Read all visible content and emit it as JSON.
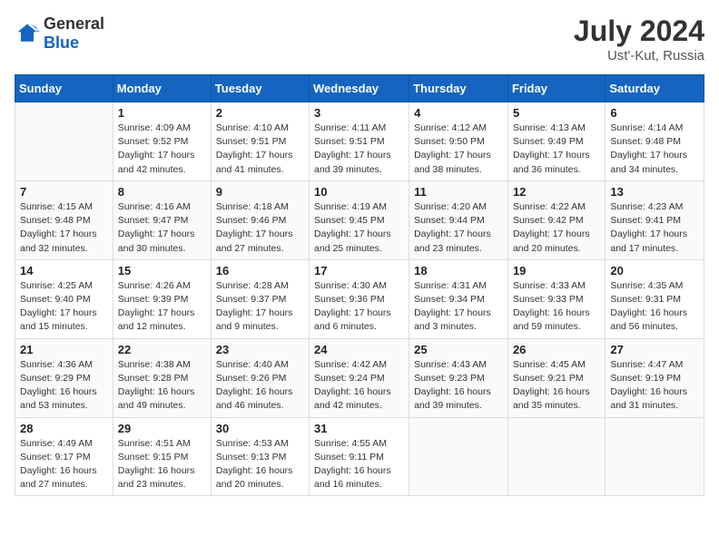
{
  "header": {
    "logo_general": "General",
    "logo_blue": "Blue",
    "month_year": "July 2024",
    "location": "Ust'-Kut, Russia"
  },
  "days_of_week": [
    "Sunday",
    "Monday",
    "Tuesday",
    "Wednesday",
    "Thursday",
    "Friday",
    "Saturday"
  ],
  "weeks": [
    [
      {
        "day": "",
        "detail": ""
      },
      {
        "day": "1",
        "detail": "Sunrise: 4:09 AM\nSunset: 9:52 PM\nDaylight: 17 hours and 42 minutes."
      },
      {
        "day": "2",
        "detail": "Sunrise: 4:10 AM\nSunset: 9:51 PM\nDaylight: 17 hours and 41 minutes."
      },
      {
        "day": "3",
        "detail": "Sunrise: 4:11 AM\nSunset: 9:51 PM\nDaylight: 17 hours and 39 minutes."
      },
      {
        "day": "4",
        "detail": "Sunrise: 4:12 AM\nSunset: 9:50 PM\nDaylight: 17 hours and 38 minutes."
      },
      {
        "day": "5",
        "detail": "Sunrise: 4:13 AM\nSunset: 9:49 PM\nDaylight: 17 hours and 36 minutes."
      },
      {
        "day": "6",
        "detail": "Sunrise: 4:14 AM\nSunset: 9:48 PM\nDaylight: 17 hours and 34 minutes."
      }
    ],
    [
      {
        "day": "7",
        "detail": "Sunrise: 4:15 AM\nSunset: 9:48 PM\nDaylight: 17 hours and 32 minutes."
      },
      {
        "day": "8",
        "detail": "Sunrise: 4:16 AM\nSunset: 9:47 PM\nDaylight: 17 hours and 30 minutes."
      },
      {
        "day": "9",
        "detail": "Sunrise: 4:18 AM\nSunset: 9:46 PM\nDaylight: 17 hours and 27 minutes."
      },
      {
        "day": "10",
        "detail": "Sunrise: 4:19 AM\nSunset: 9:45 PM\nDaylight: 17 hours and 25 minutes."
      },
      {
        "day": "11",
        "detail": "Sunrise: 4:20 AM\nSunset: 9:44 PM\nDaylight: 17 hours and 23 minutes."
      },
      {
        "day": "12",
        "detail": "Sunrise: 4:22 AM\nSunset: 9:42 PM\nDaylight: 17 hours and 20 minutes."
      },
      {
        "day": "13",
        "detail": "Sunrise: 4:23 AM\nSunset: 9:41 PM\nDaylight: 17 hours and 17 minutes."
      }
    ],
    [
      {
        "day": "14",
        "detail": "Sunrise: 4:25 AM\nSunset: 9:40 PM\nDaylight: 17 hours and 15 minutes."
      },
      {
        "day": "15",
        "detail": "Sunrise: 4:26 AM\nSunset: 9:39 PM\nDaylight: 17 hours and 12 minutes."
      },
      {
        "day": "16",
        "detail": "Sunrise: 4:28 AM\nSunset: 9:37 PM\nDaylight: 17 hours and 9 minutes."
      },
      {
        "day": "17",
        "detail": "Sunrise: 4:30 AM\nSunset: 9:36 PM\nDaylight: 17 hours and 6 minutes."
      },
      {
        "day": "18",
        "detail": "Sunrise: 4:31 AM\nSunset: 9:34 PM\nDaylight: 17 hours and 3 minutes."
      },
      {
        "day": "19",
        "detail": "Sunrise: 4:33 AM\nSunset: 9:33 PM\nDaylight: 16 hours and 59 minutes."
      },
      {
        "day": "20",
        "detail": "Sunrise: 4:35 AM\nSunset: 9:31 PM\nDaylight: 16 hours and 56 minutes."
      }
    ],
    [
      {
        "day": "21",
        "detail": "Sunrise: 4:36 AM\nSunset: 9:29 PM\nDaylight: 16 hours and 53 minutes."
      },
      {
        "day": "22",
        "detail": "Sunrise: 4:38 AM\nSunset: 9:28 PM\nDaylight: 16 hours and 49 minutes."
      },
      {
        "day": "23",
        "detail": "Sunrise: 4:40 AM\nSunset: 9:26 PM\nDaylight: 16 hours and 46 minutes."
      },
      {
        "day": "24",
        "detail": "Sunrise: 4:42 AM\nSunset: 9:24 PM\nDaylight: 16 hours and 42 minutes."
      },
      {
        "day": "25",
        "detail": "Sunrise: 4:43 AM\nSunset: 9:23 PM\nDaylight: 16 hours and 39 minutes."
      },
      {
        "day": "26",
        "detail": "Sunrise: 4:45 AM\nSunset: 9:21 PM\nDaylight: 16 hours and 35 minutes."
      },
      {
        "day": "27",
        "detail": "Sunrise: 4:47 AM\nSunset: 9:19 PM\nDaylight: 16 hours and 31 minutes."
      }
    ],
    [
      {
        "day": "28",
        "detail": "Sunrise: 4:49 AM\nSunset: 9:17 PM\nDaylight: 16 hours and 27 minutes."
      },
      {
        "day": "29",
        "detail": "Sunrise: 4:51 AM\nSunset: 9:15 PM\nDaylight: 16 hours and 23 minutes."
      },
      {
        "day": "30",
        "detail": "Sunrise: 4:53 AM\nSunset: 9:13 PM\nDaylight: 16 hours and 20 minutes."
      },
      {
        "day": "31",
        "detail": "Sunrise: 4:55 AM\nSunset: 9:11 PM\nDaylight: 16 hours and 16 minutes."
      },
      {
        "day": "",
        "detail": ""
      },
      {
        "day": "",
        "detail": ""
      },
      {
        "day": "",
        "detail": ""
      }
    ]
  ]
}
